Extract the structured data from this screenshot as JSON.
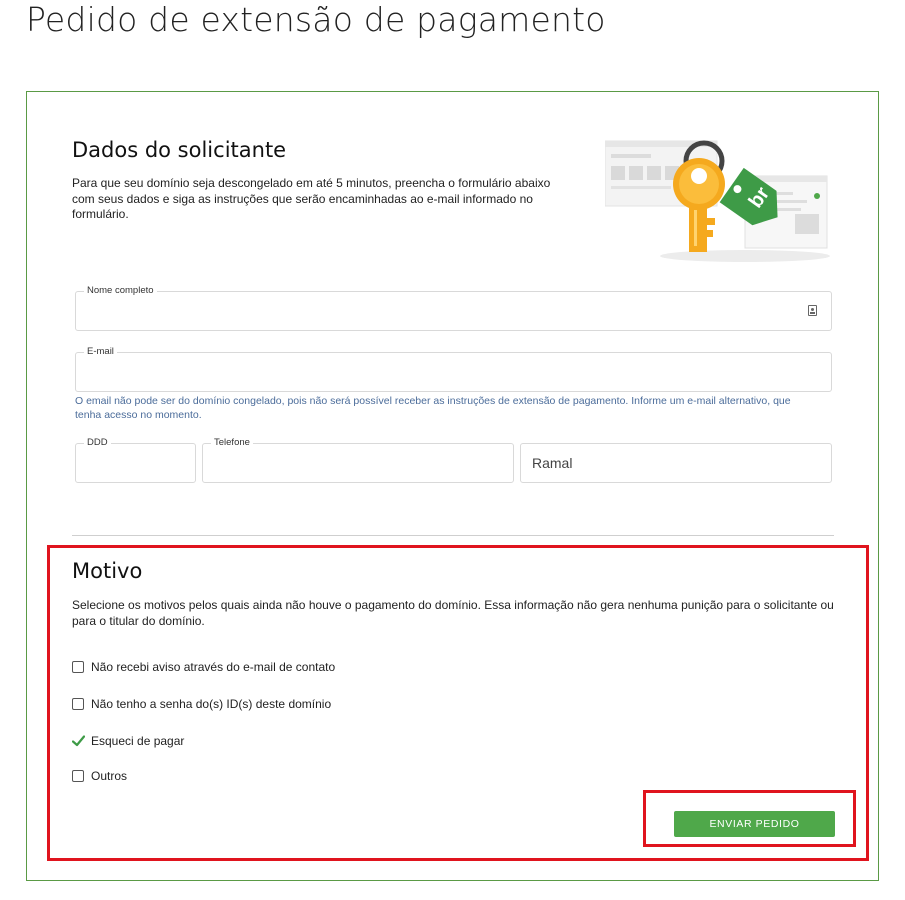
{
  "page": {
    "title": "Pedido de extensão de pagamento"
  },
  "requester": {
    "heading": "Dados do solicitante",
    "description": "Para que seu domínio seja descongelado em até 5 minutos, preencha o formulário abaixo com seus dados e siga as instruções que serão encaminhadas ao e-mail informado no formulário.",
    "illustration_badge": "br"
  },
  "form": {
    "name_label": "Nome completo",
    "email_label": "E-mail",
    "email_hint": "O email não pode ser do domínio congelado, pois não será possível receber as instruções de extensão de pagamento. Informe um e-mail alternativo, que tenha acesso no momento.",
    "ddd_label": "DDD",
    "phone_label": "Telefone",
    "extension_placeholder": "Ramal"
  },
  "reason": {
    "heading": "Motivo",
    "description": "Selecione os motivos pelos quais ainda não houve o pagamento do domínio. Essa informação não gera nenhuma punição para o solicitante ou para o titular do domínio.",
    "options": [
      {
        "label": "Não recebi aviso através do e-mail de contato",
        "checked": false
      },
      {
        "label": "Não tenho a senha do(s) ID(s) deste domínio",
        "checked": false
      },
      {
        "label": "Esqueci de pagar",
        "checked": true
      },
      {
        "label": "Outros",
        "checked": false
      }
    ]
  },
  "actions": {
    "submit_label": "ENVIAR PEDIDO"
  },
  "colors": {
    "accent_green": "#4fa84a",
    "border_green": "#5a9a45",
    "highlight_red": "#e0141e",
    "hint_blue": "#4b6c9a",
    "key_yellow": "#f5a91e"
  }
}
